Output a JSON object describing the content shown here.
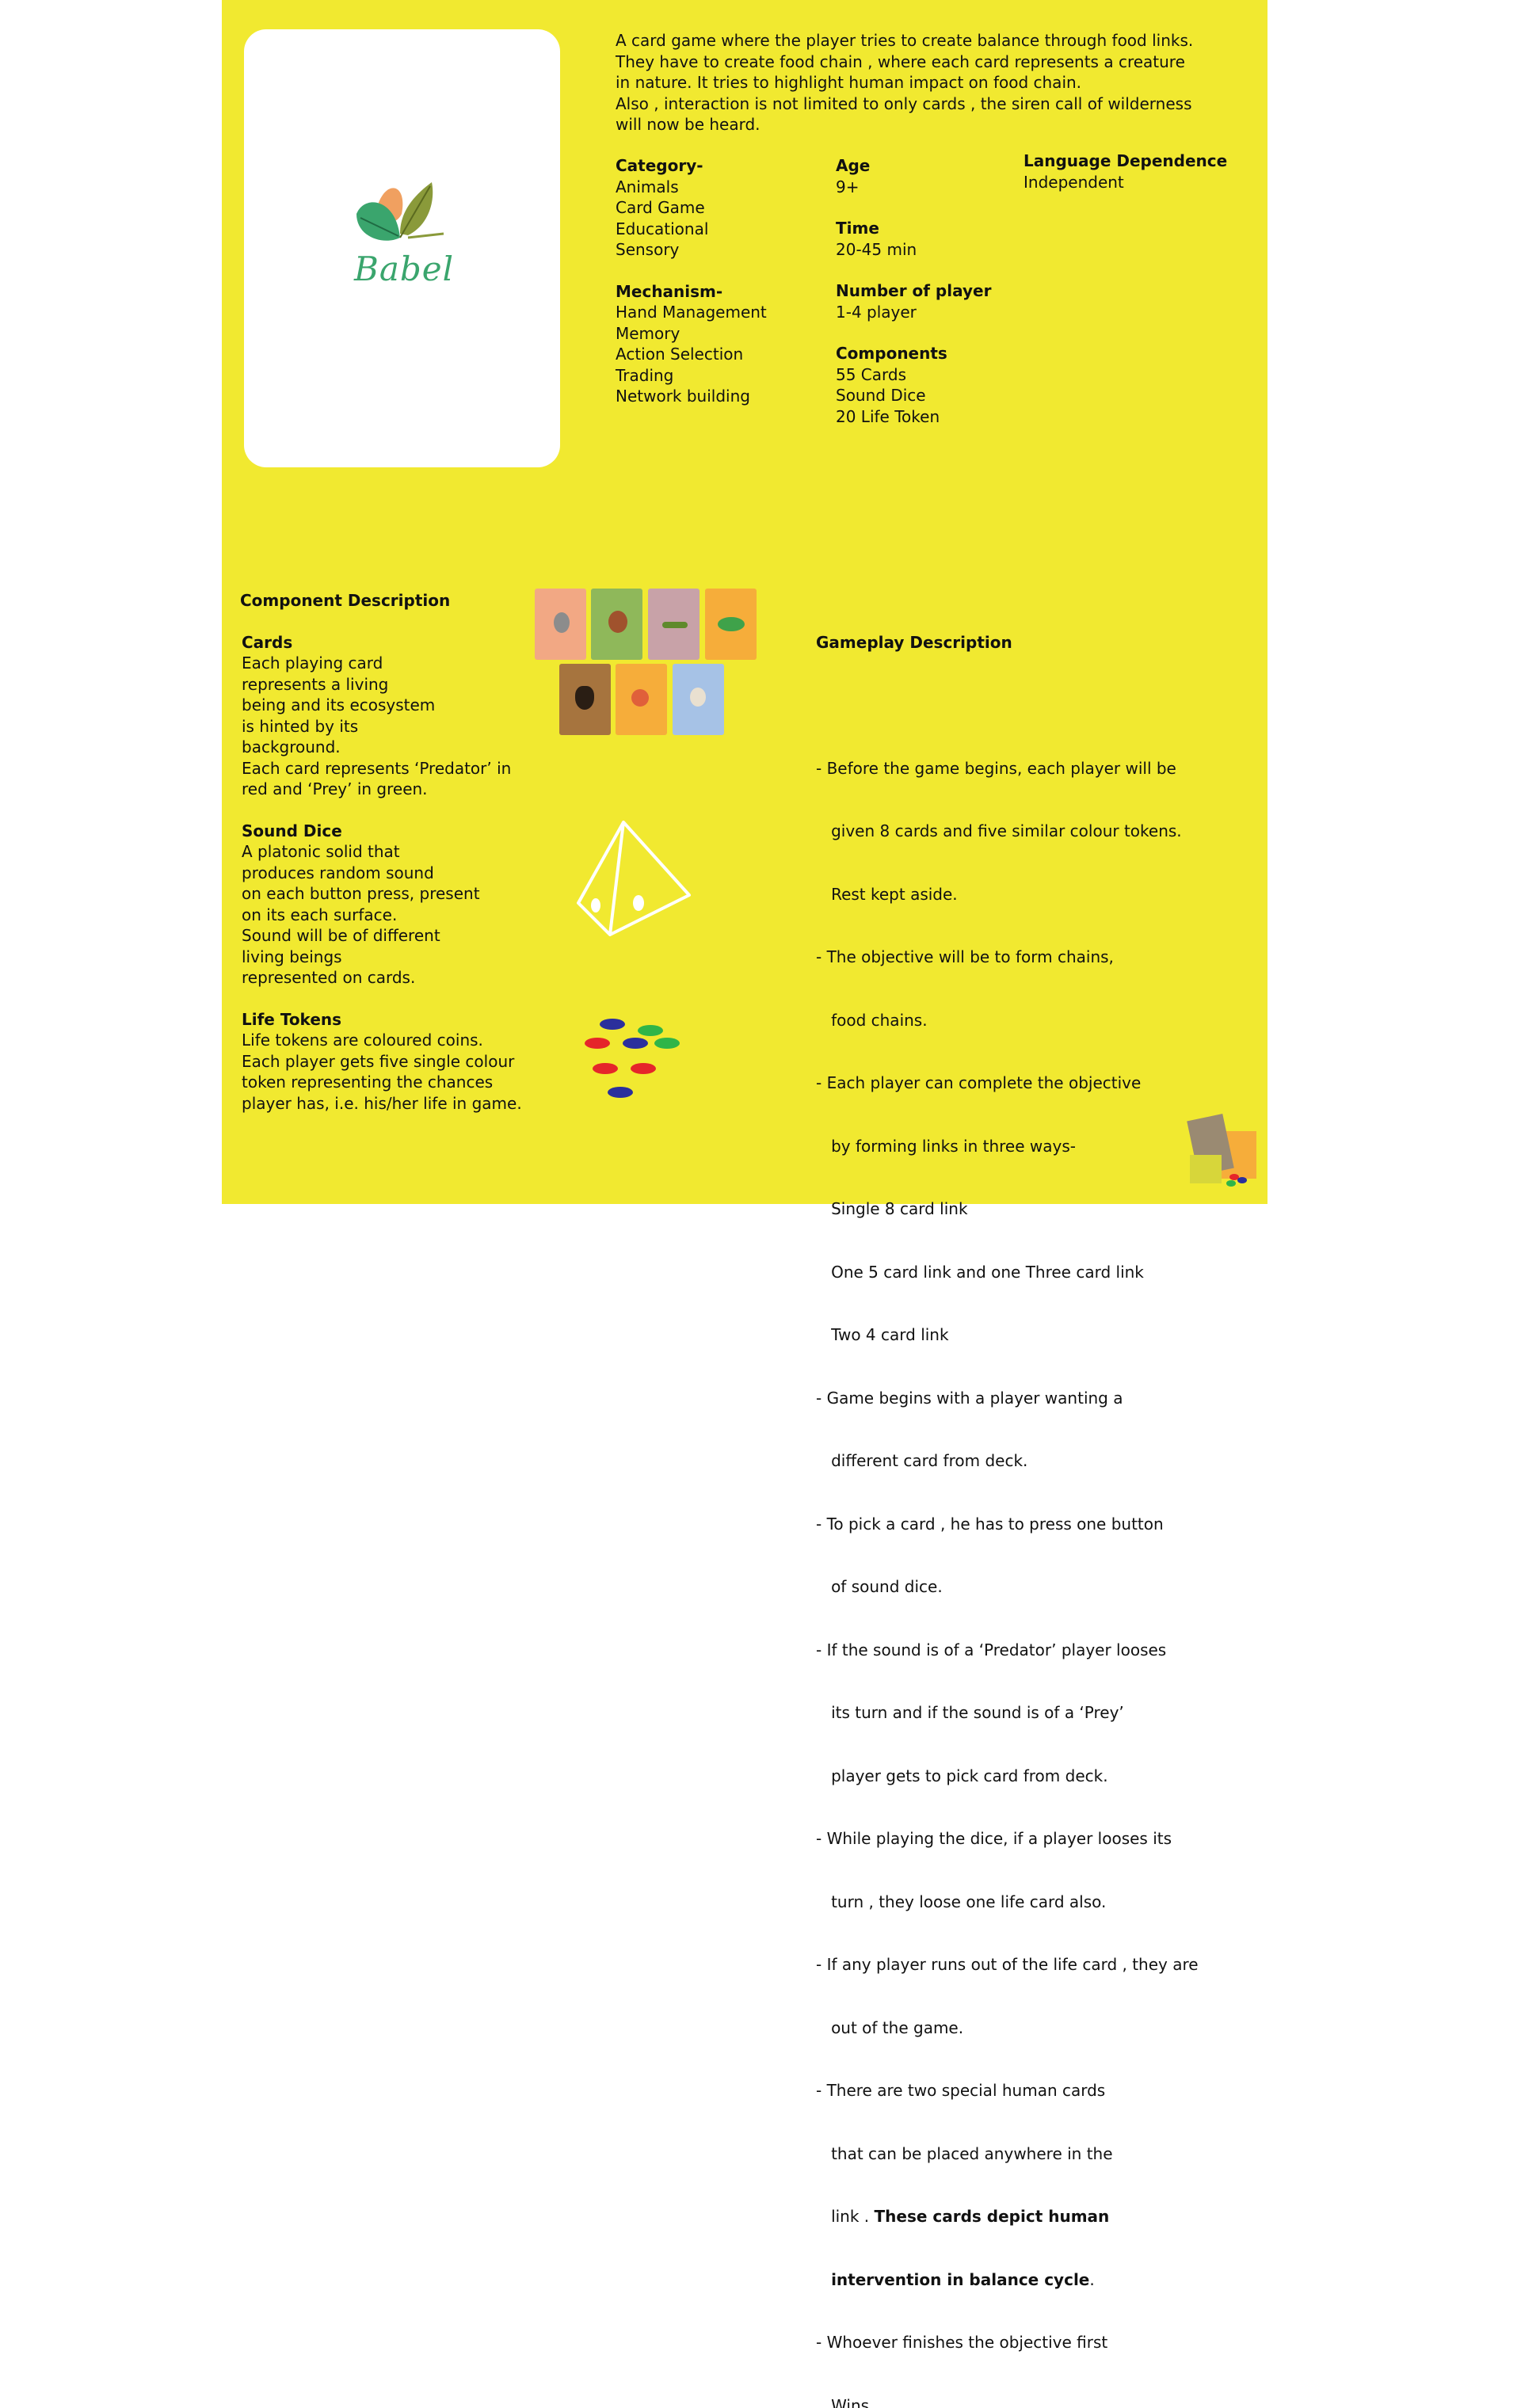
{
  "intro": {
    "lines": [
      "A card game where the player tries to create balance through food links.",
      "They have to create food chain , where each card represents a creature",
      "in nature. It tries to highlight human impact on food chain.",
      "Also , interaction is not limited to only cards , the siren call of wilderness",
      "will now be heard."
    ]
  },
  "logo": {
    "text": "Babel"
  },
  "category": {
    "title": "Category-",
    "items": [
      "Animals",
      "Card Game",
      "Educational",
      "Sensory"
    ]
  },
  "mechanism": {
    "title": "Mechanism-",
    "items": [
      "Hand Management",
      "Memory",
      "Action Selection",
      "Trading",
      "Network building"
    ]
  },
  "age": {
    "title": "Age",
    "value": "9+"
  },
  "time": {
    "title": "Time",
    "value": "20-45 min"
  },
  "players": {
    "title": "Number of player",
    "value": "1-4 player"
  },
  "components": {
    "title": "Components",
    "items": [
      "55 Cards",
      "Sound Dice",
      "20 Life Token"
    ]
  },
  "language": {
    "title": "Language Dependence",
    "value": "Independent"
  },
  "component_description": {
    "title": "Component Description",
    "cards_title": "Cards",
    "cards_lines": [
      "Each playing card",
      "represents a living",
      "being and its ecosystem",
      "is hinted by its",
      "background.",
      "Each card represents ‘Predator’ in",
      "red and ‘Prey’ in green."
    ],
    "dice_title": "Sound Dice",
    "dice_lines": [
      "A platonic solid that",
      "produces random sound",
      "on each button press, present",
      "on its each surface.",
      "Sound will be of different",
      "living beings",
      "represented on cards."
    ],
    "tokens_title": "Life Tokens",
    "tokens_lines": [
      "Life tokens are coloured coins.",
      "Each player gets five single colour",
      "token representing the chances",
      "player has, i.e. his/her life in game."
    ]
  },
  "gameplay": {
    "title": "Gameplay Description",
    "lines": [
      "- Before the game begins, each player will be",
      "   given 8 cards and five similar colour tokens.",
      "   Rest kept aside.",
      "- The objective will be to form chains,",
      "   food chains.",
      "- Each player can complete the objective",
      "   by forming links in three ways-",
      "   Single 8 card link",
      "   One 5 card link and one Three card link",
      "   Two 4 card link",
      "- Game begins with a player wanting a",
      "   different card from deck.",
      "- To pick a card , he has to press one button",
      "   of sound dice.",
      "- If the sound is of a ‘Predator’ player looses",
      "   its turn and if the sound is of a ‘Prey’",
      "   player gets to pick card from deck.",
      "- While playing the dice, if a player looses its",
      "   turn , they loose one life card also.",
      "- If any player runs out of the life card , they are",
      "   out of the game.",
      "- There are two special human cards",
      "   that can be placed anywhere in the"
    ],
    "link_plain": "   link . ",
    "link_bold": "These cards depict human",
    "bold_line": "intervention in balance cycle",
    "bold_line_end": ".",
    "final_lines": [
      "- Whoever finishes the objective first",
      "   Wins."
    ]
  },
  "colors": {
    "board": "#f1e930",
    "predator": "#d93636",
    "prey": "#2e9a5a",
    "logo": "#3aa56d"
  }
}
